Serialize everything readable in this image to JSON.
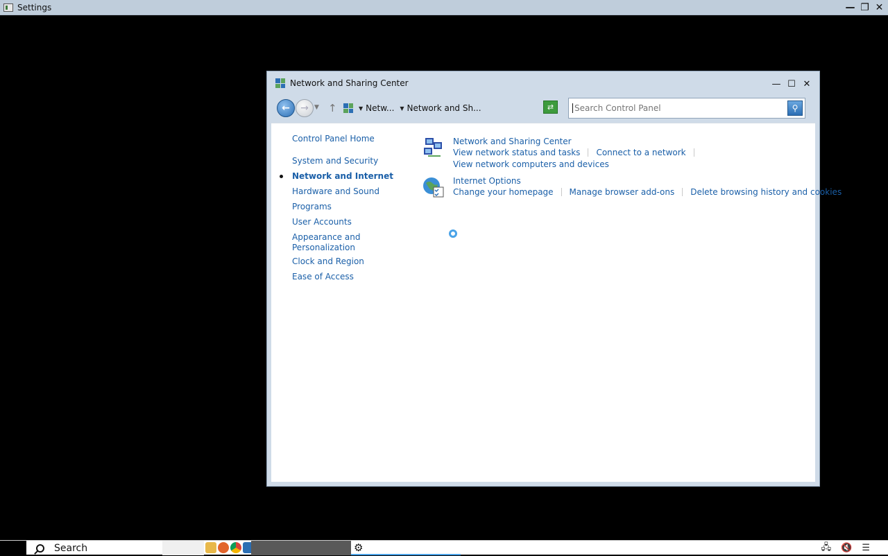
{
  "outer_window": {
    "title": "Settings"
  },
  "window": {
    "title": "Network and Sharing Center"
  },
  "navbar": {
    "breadcrumb": [
      "Netw...",
      "Network and Sh..."
    ],
    "search_placeholder": "Search Control Panel"
  },
  "sidebar": {
    "items": [
      {
        "label": "Control Panel Home"
      },
      {
        "label": "System and Security"
      },
      {
        "label": "Network and Internet",
        "active": true
      },
      {
        "label": "Hardware and Sound"
      },
      {
        "label": "Programs"
      },
      {
        "label": "User Accounts"
      },
      {
        "label": "Appearance and"
      },
      {
        "label": "Personalization"
      },
      {
        "label": "Clock and Region"
      },
      {
        "label": "Ease of Access"
      }
    ]
  },
  "sections": [
    {
      "title": "Network and Sharing Center",
      "links": [
        "View network status and tasks",
        "Connect to a network"
      ],
      "links2": [
        "View network computers and devices"
      ],
      "icon": "network-icon"
    },
    {
      "title": "Internet Options",
      "links": [
        "Change your homepage",
        "Manage browser add-ons",
        "Delete browsing history and cookies"
      ],
      "icon": "internet-options-icon"
    }
  ],
  "taskbar": {
    "search_label": "Search"
  },
  "colors": {
    "link": "#1a5fa8",
    "titlebar": "#cfdbe8",
    "accent": "#4aa3e8"
  }
}
